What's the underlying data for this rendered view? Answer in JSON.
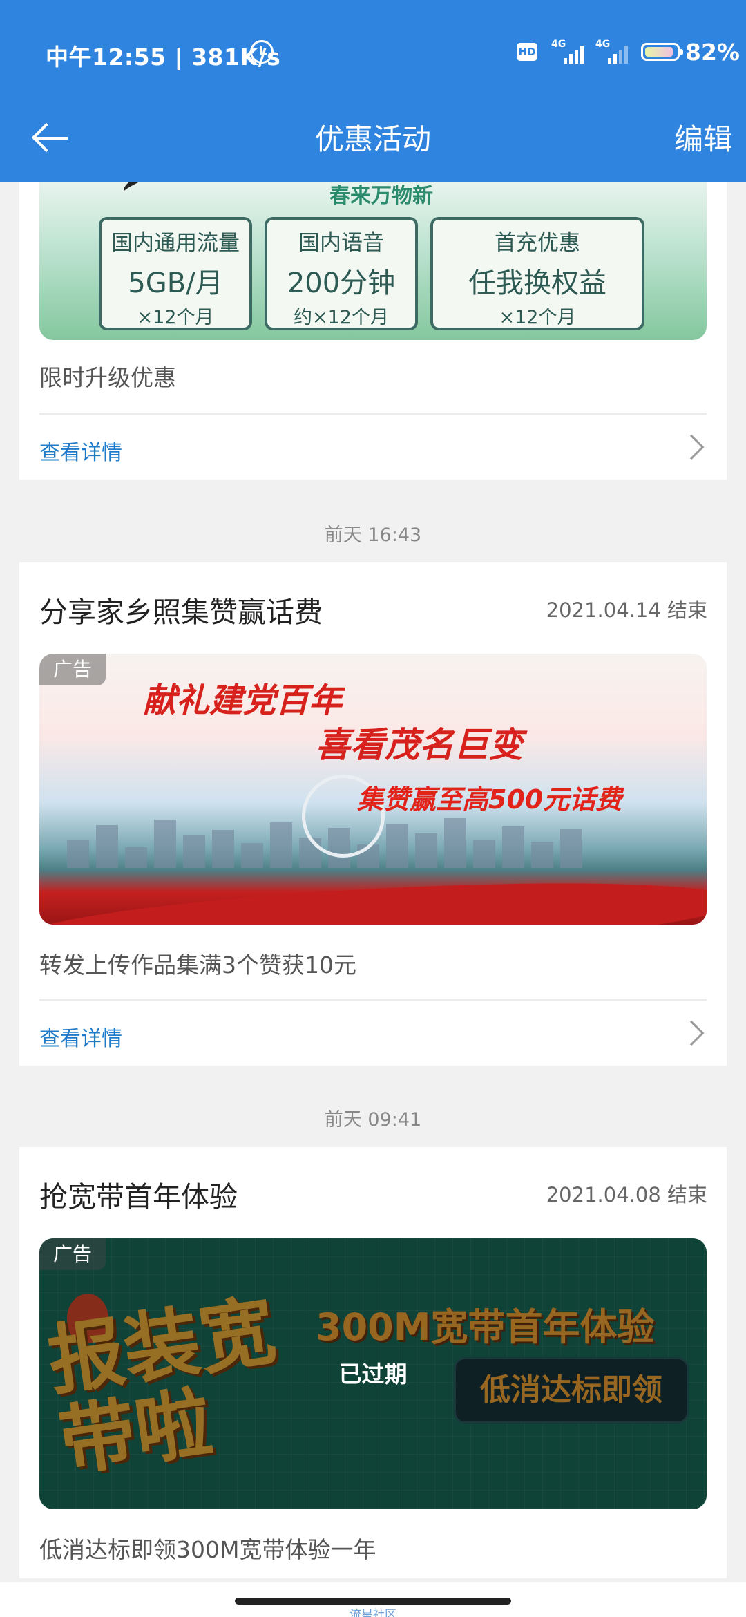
{
  "status_bar": {
    "time_speed": "中午12:55 | 381K/s",
    "hd": "HD",
    "signal1": "4G",
    "signal2": "4G",
    "battery": "82%",
    "alarm_icon": "alarm-icon"
  },
  "app_bar": {
    "title": "优惠活动",
    "edit": "编辑",
    "back_icon": "arrow-left-icon"
  },
  "cards": [
    {
      "banner": {
        "slogan": "春来万物新",
        "boxes": [
          {
            "title": "国内通用流量",
            "value": "5GB/月",
            "sub": "×12个月"
          },
          {
            "title": "国内语音",
            "value": "200分钟",
            "sub": "约×12个月"
          },
          {
            "title": "首充优惠",
            "value": "任我换权益",
            "sub": "×12个月"
          }
        ]
      },
      "desc": "限时升级优惠",
      "detail": "查看详情"
    },
    {
      "timestamp": "前天 16:43",
      "title": "分享家乡照集赞赢话费",
      "end_date": "2021.04.14 结束",
      "banner": {
        "ad_tag": "广告",
        "line1": "献礼建党百年",
        "line2": "喜看茂名巨变",
        "line3": "集赞赢至高500元话费"
      },
      "desc": "转发上传作品集满3个赞获10元",
      "detail": "查看详情"
    },
    {
      "timestamp": "前天 09:41",
      "title": "抢宽带首年体验",
      "end_date": "2021.04.08 结束",
      "banner": {
        "ad_tag": "广告",
        "big": "报装宽带啦",
        "head": "300M宽带首年体验",
        "pill": "低消达标即领",
        "expired": "已过期"
      },
      "desc": "低消达标即领300M宽带体验一年"
    }
  ],
  "watermark": "流星社区",
  "colors": {
    "primary": "#2f84df",
    "link": "#1f7bc9",
    "background": "#f1f1f1"
  }
}
